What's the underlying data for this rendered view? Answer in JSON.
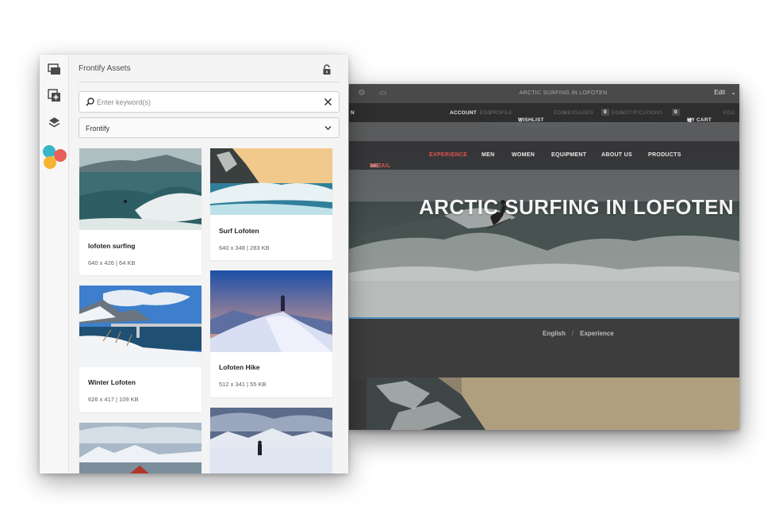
{
  "site": {
    "editor_title": "ARCTIC SURFING IN LOFOTEN",
    "mode": "Edit",
    "mode_caret": "⌄",
    "topnav": {
      "left_fragment": "N",
      "account": "ACCOUNT",
      "profile": "PROFILE",
      "wishlist": "WISHLIST",
      "messages": "MESSAGES",
      "messages_count": "0",
      "notifications": "NOTIFICATIONS",
      "notifications_count": "0",
      "cart": "MY CART",
      "ghost_tag": "EDG"
    },
    "brand": {
      "name": "WE.",
      "accent": "RETAIL",
      "accent_color": "#e0524f"
    },
    "nav": [
      "EXPERIENCE",
      "MEN",
      "WOMEN",
      "EQUIPMENT",
      "ABOUT US",
      "PRODUCTS"
    ],
    "hero_title": "ARCTIC SURFING IN LOFOTEN",
    "breadcrumb": [
      "English",
      "Experience"
    ],
    "breadcrumb_sep": "/"
  },
  "panel": {
    "title": "Frontify Assets",
    "search": {
      "placeholder": "Enter keyword(s)",
      "value": ""
    },
    "source": {
      "selected": "Frontify"
    },
    "rail_icons": [
      "assets-icon",
      "add-layer-icon",
      "layers-icon",
      "frontify-logo-icon"
    ],
    "assets": [
      {
        "name": "lofoten surfing",
        "meta": "640 x 426 | 64 KB"
      },
      {
        "name": "Surf Lofoten",
        "meta": "640 x 348 | 283 KB"
      },
      {
        "name": "Winter Lofoten",
        "meta": "626 x 417 | 109 KB"
      },
      {
        "name": "Lofoten Hike",
        "meta": "512 x 341 | 55 KB"
      },
      {
        "name": "",
        "meta": ""
      },
      {
        "name": "",
        "meta": ""
      }
    ]
  },
  "colors": {
    "accent_blue": "#4f8fc6",
    "brand_red": "#e0524f"
  }
}
